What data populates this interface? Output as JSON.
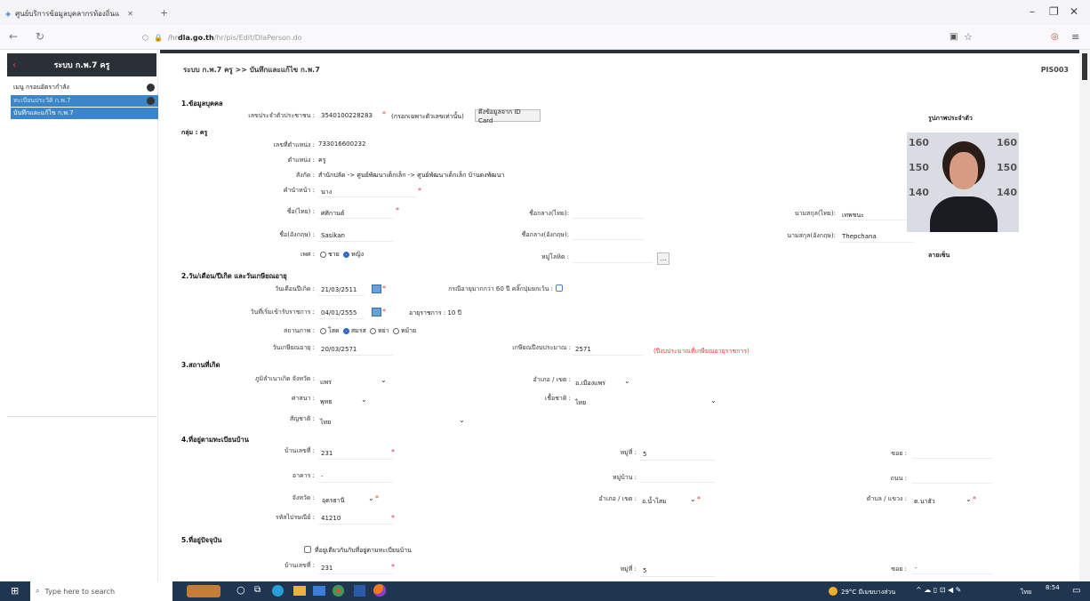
{
  "browser": {
    "tab_title": "ศูนย์บริการข้อมูลบุคลากรท้องถิ่นแ",
    "url_prefix": "/hr",
    "url_domain": "dla.go.th",
    "url_path": "/hr/pis/Edit/DlaPerson.do"
  },
  "sidebar": {
    "title": "ระบบ ก.พ.7 ครู",
    "items": [
      {
        "label": "เมนู กรอบอัตรากำลัง"
      },
      {
        "label": "ทะเบียนประวัติ ก.พ.7"
      },
      {
        "label": "บันทึกและแก้ไข ก.พ.7"
      }
    ]
  },
  "header": {
    "breadcrumb": "ระบบ ก.พ.7 ครู >> บันทึกและแก้ไข ก.พ.7",
    "page_code": "PIS003"
  },
  "section1": {
    "title": "1.ข้อมูลบุคคล",
    "id_label": "เลขประจำตัวประชาชน :",
    "id_value": "3540100228283",
    "id_note": "(กรอกเฉพาะตัวเลขเท่านั้น)",
    "id_button": "ดึงข้อมูลจาก ID Card",
    "group": "กลุ่ม : ครู",
    "position_no_label": "เลขที่ตำแหน่ง :",
    "position_no": "733016600232",
    "position_label": "ตำแหน่ง :",
    "position": "ครู",
    "affiliation_label": "สังกัด :",
    "affiliation": "สำนักปลัด -> ศูนย์พัฒนาเด็กเล็ก -> ศูนย์พัฒนาเด็กเล็ก บ้านดงพัฒนา",
    "prefix_label": "คำนำหน้า :",
    "prefix": "นาง",
    "firstname_th_label": "ชื่อ(ไทย) :",
    "firstname_th": "ศศิกานต์",
    "middlename_th_label": "ชื่อกลาง(ไทย):",
    "lastname_th_label": "นามสกุล(ไทย):",
    "lastname_th": "เทพชนะ",
    "firstname_en_label": "ชื่อ(อังกฤษ) :",
    "firstname_en": "Sasikan",
    "middlename_en_label": "ชื่อกลาง(อังกฤษ):",
    "lastname_en_label": "นามสกุล(อังกฤษ):",
    "lastname_en": "Thepchana",
    "gender_label": "เพศ :",
    "gender_male": "ชาย",
    "gender_female": "หญิง",
    "blood_label": "หมู่โลหิต :",
    "blood_button": "...",
    "photo_label": "รูปภาพประจำตัว",
    "sign_label": "ลายเซ็น"
  },
  "section2": {
    "title": "2.วัน/เดือน/ปีเกิด และวันเกษียณอายุ",
    "birth_label": "วันเดือนปีเกิด :",
    "birth": "21/03/2511",
    "over60_label": "กรณีอายุมากกว่า 60 ปี คลิ๊กปุ่มยกเว้น :",
    "start_label": "วันที่เริ่มเข้ารับราชการ :",
    "start": "04/01/2555",
    "service_age": "อายุราชการ : 10 ปี",
    "status_label": "สถานภาพ :",
    "status_single": "โสด",
    "status_married": "สมรส",
    "status_divorced": "หย่า",
    "status_widowed": "หม้าย",
    "retire_label": "วันเกษียณอายุ :",
    "retire": "20/03/2571",
    "fiscal_label": "เกษียณปีงบประมาณ :",
    "fiscal": "2571",
    "fiscal_note": "(ปีงบประมาณที่เกษียณอายุราชการ)"
  },
  "section3": {
    "title": "3.สถานที่เกิด",
    "province_label": "ภูมิลำเนาเกิด จังหวัด :",
    "province": "แพร่",
    "district_label": "อำเภอ / เขต :",
    "district": "อ.เมืองแพร่",
    "religion_label": "ศาสนา :",
    "religion": "พุทธ",
    "race_label": "เชื้อชาติ :",
    "race": "ไทย",
    "nationality_label": "สัญชาติ :",
    "nationality": "ไทย"
  },
  "section4": {
    "title": "4.ที่อยู่ตามทะเบียนบ้าน",
    "house_label": "บ้านเลขที่ :",
    "house": "231",
    "moo_label": "หมู่ที่ :",
    "moo": "5",
    "soi_label": "ซอย :",
    "building_label": "อาคาร :",
    "building": "-",
    "village_label": "หมู่บ้าน :",
    "road_label": "ถนน :",
    "province_label": "จังหวัด :",
    "province": "อุดรธานี",
    "district_label": "อำเภอ / เขต :",
    "district": "อ.น้ำโสม",
    "subdistrict_label": "ตำบล / แขวง :",
    "subdistrict": "ต.นาฮัว",
    "zip_label": "รหัสไปรษณีย์ :",
    "zip": "41210"
  },
  "section5": {
    "title": "5.ที่อยู่ปัจจุบัน",
    "same_label": "ที่อยู่เดียวกันกับที่อยู่ตามทะเบียนบ้าน",
    "house_label": "บ้านเลขที่ :",
    "house": "231",
    "moo_label": "หมู่ที่ :",
    "moo": "5",
    "soi_label": "ซอย :",
    "soi": "-"
  },
  "taskbar": {
    "search_placeholder": "Type here to search",
    "weather": "29°C มีเมฆบางส่วน",
    "lang": "ไทย",
    "time": "8:54"
  },
  "colors": {
    "accent": "#3a86c8",
    "required": "#e53935",
    "sidebar_dark": "#2b2f36"
  }
}
